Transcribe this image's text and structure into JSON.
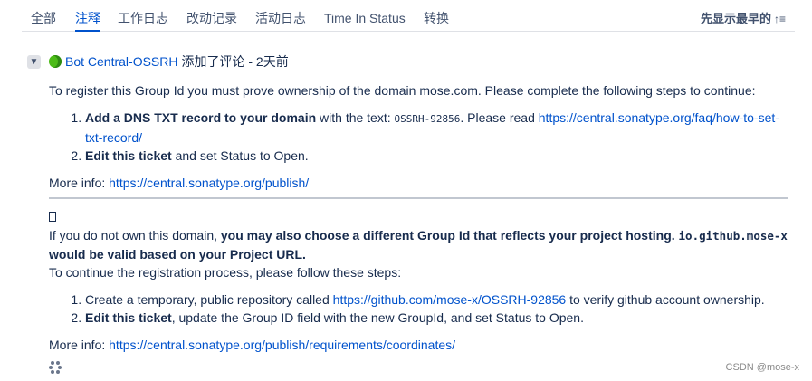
{
  "tabs": {
    "all": "全部",
    "comments": "注释",
    "worklog": "工作日志",
    "history": "改动记录",
    "activity": "活动日志",
    "time_in_status": "Time In Status",
    "transitions": "转换"
  },
  "sort": {
    "label": "先显示最早的",
    "icon": "↑≡"
  },
  "comment": {
    "author": "Bot Central-OSSRH",
    "action": "添加了评论 - 2天前"
  },
  "content": {
    "intro": "To register this Group Id you must prove ownership of the domain mose.com. Please complete the following steps to continue:",
    "step1_bold": "Add a DNS TXT record to your domain",
    "step1_text": " with the text: ",
    "step1_code": "OSSRH-92856",
    "step1_after": ". Please read ",
    "step1_link": "https://central.sonatype.org/faq/how-to-set-txt-record/",
    "step2_bold": "Edit this ticket",
    "step2_text": " and set Status to Open.",
    "more1_label": "More info: ",
    "more1_link": "https://central.sonatype.org/publish/",
    "para2_start": "If you do not own this domain, ",
    "para2_bold": "you may also choose a different Group Id that reflects your project hosting. ",
    "para2_code": "io.github.mose-x",
    "para2_bold_end": " would be valid based on your Project URL.",
    "continue_text": "To continue the registration process, please follow these steps:",
    "s2_step1_text": "Create a temporary, public repository called ",
    "s2_step1_link": "https://github.com/mose-x/OSSRH-92856",
    "s2_step1_after": " to verify github account ownership.",
    "s2_step2_bold": "Edit this ticket",
    "s2_step2_text": ", update the Group ID field with the new GroupId, and set Status to Open.",
    "more2_label": "More info: ",
    "more2_link": "https://central.sonatype.org/publish/requirements/coordinates/"
  },
  "watermark": "CSDN @mose-x",
  "colors": {
    "link": "#0052cc",
    "text": "#172b4d",
    "avatar": "#4cbb17"
  }
}
